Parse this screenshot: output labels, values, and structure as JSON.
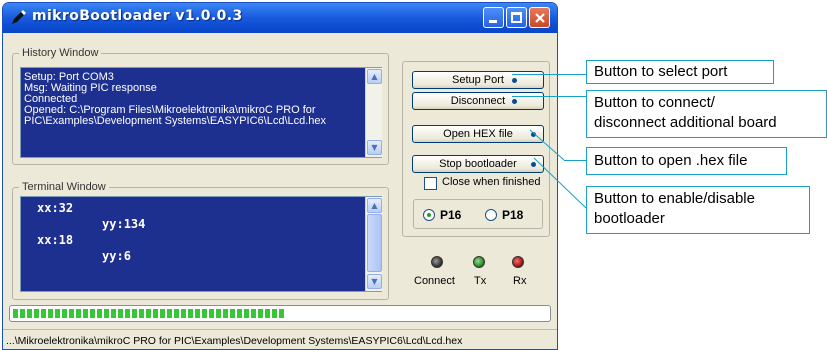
{
  "window": {
    "title": "mikroBootloader  v1.0.0.3"
  },
  "history": {
    "legend": "History Window",
    "lines": [
      "Setup: Port COM3",
      "Msg: Waiting PIC response",
      "Connected",
      "Opened: C:\\Program Files\\Mikroelektronika\\mikroC PRO for",
      "PIC\\Examples\\Development Systems\\EASYPIC6\\Lcd\\Lcd.hex"
    ]
  },
  "terminal": {
    "legend": "Terminal Window",
    "lines": [
      "xx:32",
      "         yy:134",
      "xx:18",
      "         yy:6"
    ]
  },
  "buttons": {
    "setup_port": "Setup Port",
    "disconnect": "Disconnect",
    "open_hex": "Open HEX file",
    "stop_bootloader": "Stop bootloader"
  },
  "close_when_finished": {
    "label": "Close when finished",
    "checked": false
  },
  "device": {
    "options": [
      "P16",
      "P18"
    ],
    "selected": "P16"
  },
  "indicators": [
    {
      "label": "Connect",
      "color": "#2a2a2a"
    },
    {
      "label": "Tx",
      "color": "#1f7a1f"
    },
    {
      "label": "Rx",
      "color": "#8a0f0f"
    }
  ],
  "progress": {
    "fraction": 0.51
  },
  "status_path": "...\\Mikroelektronika\\mikroC PRO for PIC\\Examples\\Development Systems\\EASYPIC6\\Lcd\\Lcd.hex",
  "callouts": [
    "Button to select port",
    "Button to connect/",
    "disconnect additional board",
    "Button to open .hex file",
    "Button to enable/disable",
    "bootloader"
  ],
  "colors": {
    "accent": "#1aa0c8",
    "log_background": "#1d2f8f",
    "progress": "#37c637"
  }
}
